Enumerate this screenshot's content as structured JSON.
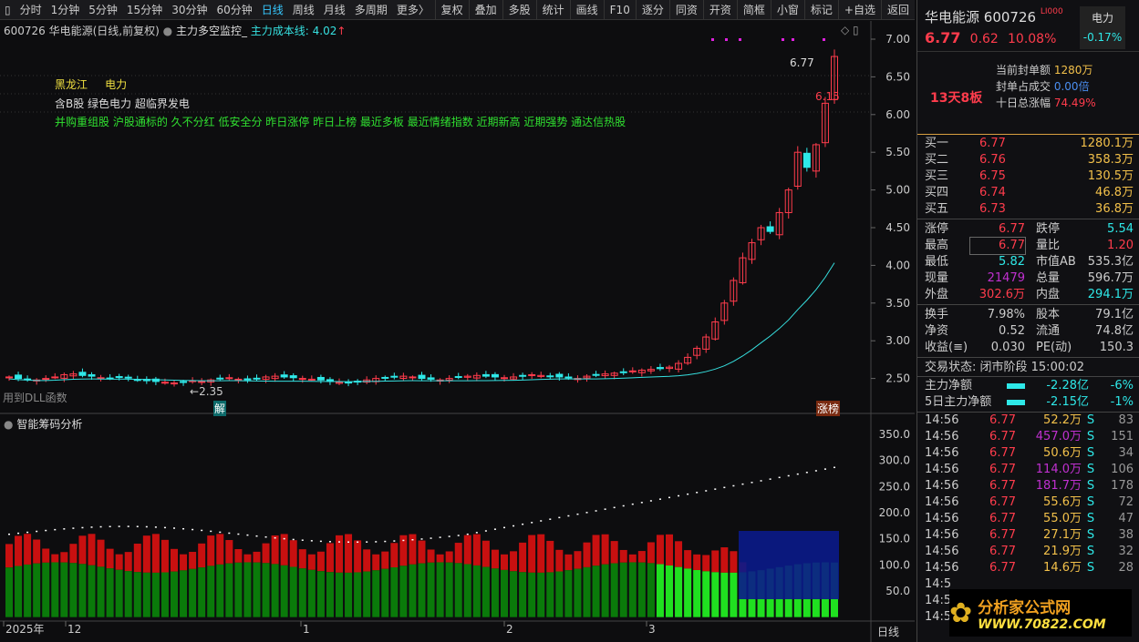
{
  "toolbar": {
    "periods": [
      "分时",
      "1分钟",
      "5分钟",
      "15分钟",
      "30分钟",
      "60分钟",
      "日线",
      "周线",
      "月线",
      "多周期",
      "更多〉"
    ],
    "active": "日线",
    "buttons": [
      "复权",
      "叠加",
      "多股",
      "统计",
      "画线",
      "F10",
      "逐分",
      "同资",
      "开资",
      "简框",
      "小窗",
      "标记",
      "+自选",
      "返回"
    ]
  },
  "info": {
    "title": "600726 华电能源(日线,前复权)",
    "indicator": "主力多空监控_",
    "cost_line": "主力成本线: 4.02"
  },
  "tags": {
    "region": "黑龙江",
    "industry": "电力",
    "concepts": "含B股 绿色电力 超临界发电",
    "labels": "并购重组股 沪股通标的 久不分红 低安全分 昨日涨停 昨日上榜 最近多板 最近情绪指数 近期新高 近期强势 通达信热股"
  },
  "annotations": {
    "high": "6.77",
    "prev": "6.15",
    "low": "2.35",
    "dll": "用到DLL函数",
    "jie": "解",
    "zhangbang": "涨榜"
  },
  "chip_panel": {
    "title": "智能筹码分析"
  },
  "x_axis": {
    "labels": [
      "2025年",
      "12",
      "1",
      "2",
      "3"
    ],
    "period": "日线"
  },
  "chart_data": {
    "type": "candlestick",
    "price_axis": [
      "7.00",
      "6.50",
      "6.00",
      "5.50",
      "5.00",
      "4.50",
      "4.00",
      "3.50",
      "3.00",
      "2.50"
    ],
    "ylim": [
      2.3,
      7.1
    ],
    "closes": [
      2.52,
      2.5,
      2.49,
      2.48,
      2.5,
      2.52,
      2.55,
      2.56,
      2.54,
      2.53,
      2.51,
      2.5,
      2.52,
      2.51,
      2.48,
      2.47,
      2.46,
      2.45,
      2.44,
      2.45,
      2.47,
      2.46,
      2.48,
      2.5,
      2.51,
      2.49,
      2.48,
      2.5,
      2.52,
      2.53,
      2.52,
      2.51,
      2.5,
      2.49,
      2.48,
      2.46,
      2.45,
      2.44,
      2.46,
      2.48,
      2.5,
      2.51,
      2.52,
      2.53,
      2.52,
      2.5,
      2.49,
      2.48,
      2.5,
      2.52,
      2.53,
      2.54,
      2.53,
      2.52,
      2.51,
      2.52,
      2.53,
      2.55,
      2.54,
      2.53,
      2.52,
      2.51,
      2.5,
      2.53,
      2.55,
      2.56,
      2.57,
      2.58,
      2.6,
      2.61,
      2.62,
      2.63,
      2.65,
      2.7,
      2.78,
      2.9,
      3.05,
      3.25,
      3.5,
      3.8,
      4.1,
      4.3,
      4.5,
      4.45,
      4.7,
      5.0,
      5.5,
      5.3,
      5.6,
      6.15,
      6.77
    ],
    "chip_axis": [
      "350.0",
      "300.0",
      "250.0",
      "200.0",
      "150.0",
      "100.0",
      "50.0"
    ],
    "chip_ylim": [
      0,
      370
    ]
  },
  "quote": {
    "name": "华电能源",
    "code": "600726",
    "flag": "LI000",
    "price": "6.77",
    "change": "0.62",
    "pct": "10.08%",
    "sector": "电力",
    "sector_pct": "-0.17%",
    "streak": "13天8板",
    "seal_label": "当前封单额",
    "seal": "1280万",
    "ratio_label": "封单占成交",
    "ratio": "0.00倍",
    "ten_label": "十日总涨幅",
    "ten": "74.49%"
  },
  "book": [
    {
      "l": "买一",
      "p": "6.77",
      "v": "1280.1万"
    },
    {
      "l": "买二",
      "p": "6.76",
      "v": "358.3万"
    },
    {
      "l": "买三",
      "p": "6.75",
      "v": "130.5万"
    },
    {
      "l": "买四",
      "p": "6.74",
      "v": "46.8万"
    },
    {
      "l": "买五",
      "p": "6.73",
      "v": "36.8万"
    }
  ],
  "stats": [
    [
      "涨停",
      "6.77",
      "跌停",
      "5.54"
    ],
    [
      "最高",
      "6.77",
      "量比",
      "1.20"
    ],
    [
      "最低",
      "5.82",
      "市值AB",
      "535.3亿"
    ],
    [
      "现量",
      "21479",
      "总量",
      "596.7万"
    ],
    [
      "外盘",
      "302.6万",
      "内盘",
      "294.1万"
    ]
  ],
  "stats2": [
    [
      "换手",
      "7.98%",
      "股本",
      "79.1亿"
    ],
    [
      "净资",
      "0.52",
      "流通",
      "74.8亿"
    ],
    [
      "收益(≡)",
      "0.030",
      "PE(动)",
      "150.3"
    ]
  ],
  "status": "交易状态: 闭市阶段 15:00:02",
  "flows": [
    {
      "l": "主力净额",
      "v": "-2.28亿",
      "p": "-6%"
    },
    {
      "l": "5日主力净额",
      "v": "-2.15亿",
      "p": "-1%"
    }
  ],
  "ticks": [
    [
      "14:56",
      "6.77",
      "52.2万",
      "S",
      "83"
    ],
    [
      "14:56",
      "6.77",
      "457.0万",
      "S",
      "151"
    ],
    [
      "14:56",
      "6.77",
      "50.6万",
      "S",
      "34"
    ],
    [
      "14:56",
      "6.77",
      "114.0万",
      "S",
      "106"
    ],
    [
      "14:56",
      "6.77",
      "181.7万",
      "S",
      "178"
    ],
    [
      "14:56",
      "6.77",
      "55.6万",
      "S",
      "72"
    ],
    [
      "14:56",
      "6.77",
      "55.0万",
      "S",
      "47"
    ],
    [
      "14:56",
      "6.77",
      "27.1万",
      "S",
      "38"
    ],
    [
      "14:56",
      "6.77",
      "21.9万",
      "S",
      "32"
    ],
    [
      "14:56",
      "6.77",
      "14.6万",
      "S",
      "28"
    ],
    [
      "14:5",
      "",
      "",
      "",
      ""
    ],
    [
      "14:5",
      "",
      "",
      "",
      ""
    ],
    [
      "14:5",
      "",
      "",
      "",
      ""
    ]
  ],
  "logo": {
    "name": "分析家公式网",
    "url": "WWW.70822.COM"
  },
  "colors": {
    "up": "#ff3c4c",
    "down": "#2ee8e8",
    "cost": "#36e0e0"
  }
}
